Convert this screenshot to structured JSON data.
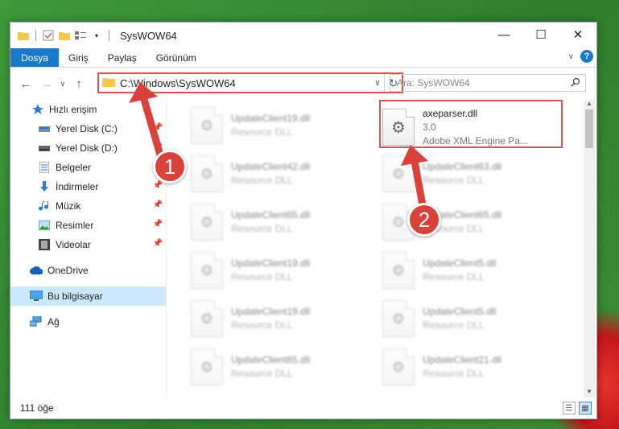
{
  "window": {
    "title": "SysWOW64",
    "controls": {
      "minimize": "—",
      "maximize": "☐",
      "close": "✕"
    }
  },
  "ribbon": {
    "tabs": [
      {
        "label": "Dosya",
        "active": true
      },
      {
        "label": "Giriş"
      },
      {
        "label": "Paylaş"
      },
      {
        "label": "Görünüm"
      }
    ],
    "help": "?"
  },
  "address": {
    "path": "C:\\Windows\\SysWOW64",
    "search_placeholder": "Ara: SysWOW64"
  },
  "sidebar": {
    "items": [
      {
        "label": "Hızlı erişim",
        "icon": "star-icon",
        "pinned": false
      },
      {
        "label": "Yerel Disk (C:)",
        "icon": "drive-icon",
        "pinned": true
      },
      {
        "label": "Yerel Disk (D:)",
        "icon": "drive-icon",
        "pinned": true
      },
      {
        "label": "Belgeler",
        "icon": "documents-icon",
        "pinned": true
      },
      {
        "label": "İndirmeler",
        "icon": "download-icon",
        "pinned": true
      },
      {
        "label": "Müzik",
        "icon": "music-icon",
        "pinned": true
      },
      {
        "label": "Resimler",
        "icon": "pictures-icon",
        "pinned": true
      },
      {
        "label": "Videolar",
        "icon": "videos-icon",
        "pinned": true
      },
      {
        "label": "OneDrive",
        "icon": "cloud-icon",
        "pinned": false
      },
      {
        "label": "Bu bilgisayar",
        "icon": "computer-icon",
        "pinned": false,
        "selected": true
      },
      {
        "label": "Ağ",
        "icon": "network-icon",
        "pinned": false
      }
    ]
  },
  "files": {
    "featured": {
      "name": "axeparser.dll",
      "version": "3.0",
      "description": "Adobe XML Engine Pa..."
    },
    "left_column": [
      {
        "name": "UpdateClient19.dll",
        "type": "Resource DLL"
      },
      {
        "name": "UpdateClient42.dll",
        "type": "Resource DLL"
      },
      {
        "name": "UpdateClient65.dll",
        "type": "Resource DLL"
      },
      {
        "name": "UpdateClient19.dll",
        "type": "Resource DLL"
      },
      {
        "name": "UpdateClient19.dll",
        "type": "Resource DLL"
      },
      {
        "name": "UpdateClient65.dll",
        "type": "Resource DLL"
      }
    ],
    "right_column": [
      {
        "name": "UpdateClient63.dll",
        "type": "Resource DLL"
      },
      {
        "name": "UpdateClient65.dll",
        "type": "Resource DLL"
      },
      {
        "name": "UpdateClient5.dll",
        "type": "Resource DLL"
      },
      {
        "name": "UpdateClient5.dll",
        "type": "Resource DLL"
      },
      {
        "name": "UpdateClient21.dll",
        "type": "Resource DLL"
      }
    ]
  },
  "status": {
    "count": "111 öğe"
  },
  "annotations": {
    "step1": "1",
    "step2": "2",
    "color": "#d9423a"
  }
}
